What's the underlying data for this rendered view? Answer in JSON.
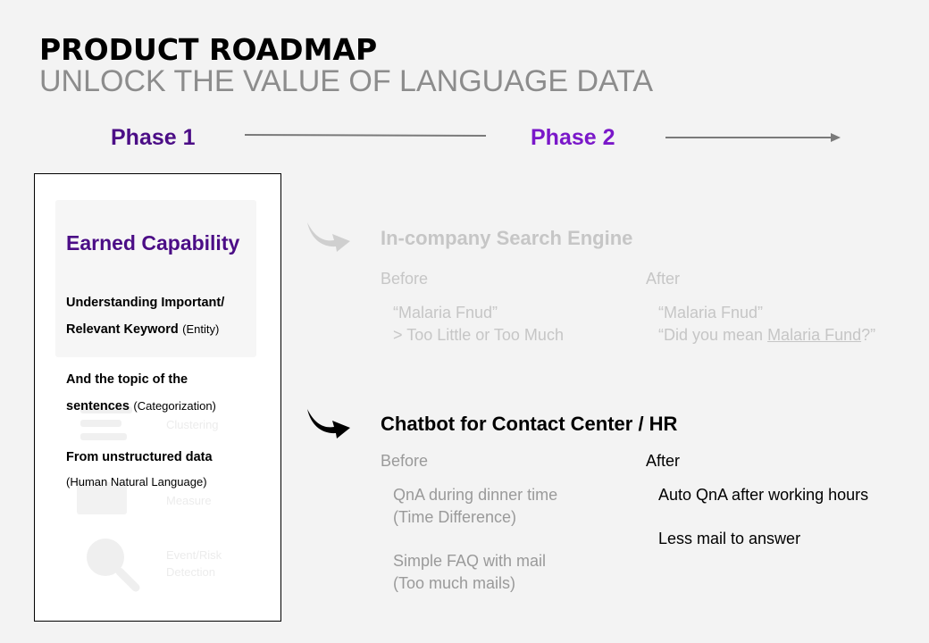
{
  "header": {
    "title": "PRODUCT ROADMAP",
    "subtitle": "UNLOCK THE VALUE OF LANGUAGE DATA"
  },
  "phases": [
    {
      "label": "Phase 1"
    },
    {
      "label": "Phase 2"
    }
  ],
  "capability": {
    "title": "Earned Capability",
    "items": [
      {
        "line1": "Understanding Important/",
        "line2_bold": "Relevant Keyword",
        "line2_note": "(Entity)"
      },
      {
        "line1": "And the topic of the",
        "line2_bold": "sentences",
        "line2_note": "(Categorization)"
      },
      {
        "line1": "From unstructured data",
        "note": "(Human Natural Language)"
      }
    ],
    "background_labels": [
      "Clustering",
      "Measure",
      "Event/Risk",
      "Detection"
    ]
  },
  "use_cases": [
    {
      "title": "In-company Search Engine",
      "before_label": "Before",
      "after_label": "After",
      "before_lines": [
        "“Malaria Fnud”",
        "> Too Little or Too Much"
      ],
      "after_line1": "“Malaria Fnud”",
      "after_line2_prefix": "“Did you mean ",
      "after_line2_link": "Malaria Fund",
      "after_line2_suffix": "?”"
    },
    {
      "title": "Chatbot for Contact Center / HR",
      "before_label": "Before",
      "after_label": "After",
      "before_lines": [
        "QnA during dinner time",
        "(Time Difference)",
        "Simple FAQ with mail",
        "(Too much mails)"
      ],
      "after_lines": [
        "Auto QnA after working hours",
        "Less mail to answer"
      ]
    }
  ],
  "colors": {
    "phase1": "#4b0d86",
    "phase2": "#7a17c9",
    "dim": "#c6c6c6"
  }
}
